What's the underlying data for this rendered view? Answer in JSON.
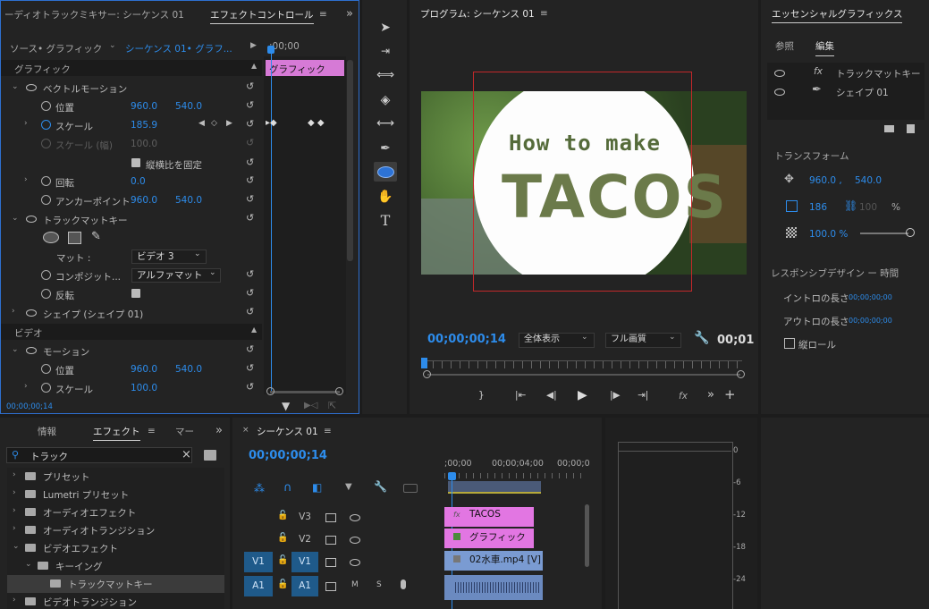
{
  "effect_controls": {
    "tab_mixer": "ーディオトラックミキサー: シーケンス 01",
    "tab_effect_controls": "エフェクトコントロール",
    "source_label": "ソース• グラフィック",
    "sequence_label": "シーケンス 01• グラフ...",
    "ruler_time": ";00;00",
    "clip_label": "グラフィック",
    "section_graphic": "グラフィック",
    "vector_motion": "ベクトルモーション",
    "position_label": "位置",
    "position_x": "960.0",
    "position_y": "540.0",
    "scale_label": "スケール",
    "scale_value": "185.9",
    "scale_width_label": "スケール (幅)",
    "scale_width_value": "100.0",
    "uniform_scale_label": "縦横比を固定",
    "rotation_label": "回転",
    "rotation_value": "0.0",
    "anchor_label": "アンカーポイント",
    "anchor_x": "960.0",
    "anchor_y": "540.0",
    "track_matte_key": "トラックマットキー",
    "matte_label": "マット :",
    "matte_value": "ビデオ 3",
    "composite_label": "コンポジット...",
    "composite_value": "アルファマット",
    "reverse_label": "反転",
    "shape_label": "シェイプ (シェイプ 01)",
    "section_video": "ビデオ",
    "motion_label": "モーション",
    "motion_position_label": "位置",
    "motion_position_x": "960.0",
    "motion_position_y": "540.0",
    "motion_scale_label": "スケール",
    "motion_scale_value": "100.0",
    "timecode": "00;00;00;14"
  },
  "program": {
    "title": "プログラム: シーケンス 01",
    "video_text_small": "How to make",
    "video_text_big": "TACOS",
    "timecode": "00;00;00;14",
    "zoom_value": "全体表示",
    "quality_value": "フル画質",
    "end_timecode": "00;01"
  },
  "essential_graphics": {
    "title": "エッセンシャルグラフィックス",
    "tab_browse": "参照",
    "tab_edit": "編集",
    "layer_fx": "トラックマットキー",
    "layer_shape": "シェイプ 01",
    "transform_label": "トランスフォーム",
    "pos_x": "960.0 ,",
    "pos_y": "540.0",
    "scale_value": "186",
    "scale_width": "100",
    "percent": "%",
    "opacity_value": "100.0 %",
    "responsive_label": "レスポンシブデザイン ー 時間",
    "intro_label": "イントロの長さ",
    "intro_value": "00;00;00;00",
    "outro_label": "アウトロの長さ",
    "outro_value": "00;00;00;00",
    "roll_label": "縦ロール"
  },
  "effects_panel": {
    "tab_info": "情報",
    "tab_effects": "エフェクト",
    "tab_more": "マー",
    "search_value": "トラック",
    "items": [
      {
        "label": "プリセット",
        "depth": 0,
        "open": false
      },
      {
        "label": "Lumetri プリセット",
        "depth": 0,
        "open": false
      },
      {
        "label": "オーディオエフェクト",
        "depth": 0,
        "open": false
      },
      {
        "label": "オーディオトランジション",
        "depth": 0,
        "open": false
      },
      {
        "label": "ビデオエフェクト",
        "depth": 0,
        "open": true
      },
      {
        "label": "キーイング",
        "depth": 1,
        "open": true
      },
      {
        "label": "トラックマットキー",
        "depth": 2,
        "open": false
      },
      {
        "label": "ビデオトランジション",
        "depth": 0,
        "open": false
      }
    ]
  },
  "timeline": {
    "tab": "シーケンス 01",
    "timecode": "00;00;00;14",
    "ruler_labels": [
      ";00;00",
      "00;00;04;00",
      "00;00;0"
    ],
    "tracks": [
      {
        "src": "",
        "name": "V3",
        "kind": "video"
      },
      {
        "src": "",
        "name": "V2",
        "kind": "video"
      },
      {
        "src": "V1",
        "name": "V1",
        "kind": "video"
      },
      {
        "src": "A1",
        "name": "A1",
        "kind": "audio"
      }
    ],
    "audio_m": "M",
    "audio_s": "S",
    "clip_tacos": "TACOS",
    "clip_graphic": "グラフィック",
    "clip_video": "02水車.mp4 [V]"
  },
  "meter": {
    "labels": [
      "0",
      "-6",
      "-12",
      "-18",
      "-24"
    ]
  }
}
